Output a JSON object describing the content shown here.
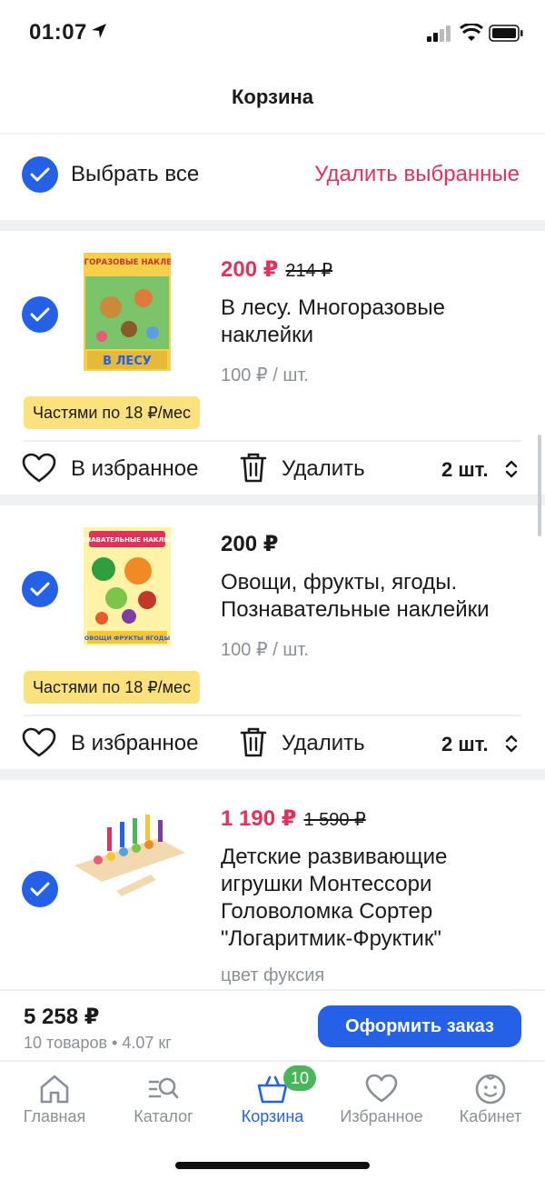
{
  "status_bar": {
    "time": "01:07"
  },
  "header": {
    "title": "Корзина"
  },
  "select_all": {
    "label": "Выбрать все",
    "delete_selected": "Удалить выбранные"
  },
  "items": [
    {
      "price": "200 ₽",
      "old_price": "214 ₽",
      "name": "В лесу. Многоразовые наклейки",
      "unit_price": "100 ₽ / шт.",
      "installment": "Частями по 18 ₽/мес",
      "favorite_label": "В избранное",
      "delete_label": "Удалить",
      "quantity": "2 шт.",
      "cover_title": "МНОГОРАЗОВЫЕ НАКЛЕЙКИ",
      "cover_bottom": "В ЛЕСУ"
    },
    {
      "price": "200 ₽",
      "name": "Овощи, фрукты, ягоды. Познавательные наклейки",
      "unit_price": "100 ₽ / шт.",
      "installment": "Частями по 18 ₽/мес",
      "favorite_label": "В избранное",
      "delete_label": "Удалить",
      "quantity": "2 шт.",
      "cover_title": "ПОЗНАВАТЕЛЬНЫЕ НАКЛЕЙКИ",
      "cover_bottom": "ОВОЩИ ФРУКТЫ ЯГОДЫ"
    },
    {
      "price": "1 190 ₽",
      "old_price": "1 590 ₽",
      "name": "Детские развивающие игрушки Монтессори Головоломка Сортер \"Логаритмик-Фруктик\"",
      "color_option": "цвет фуксия"
    }
  ],
  "summary": {
    "total": "5 258 ₽",
    "details": "10 товаров • 4.07 кг",
    "checkout_label": "Оформить заказ"
  },
  "tabbar": {
    "tabs": [
      {
        "label": "Главная",
        "icon": "home-icon"
      },
      {
        "label": "Каталог",
        "icon": "catalog-search-icon"
      },
      {
        "label": "Корзина",
        "icon": "basket-icon",
        "active": true,
        "badge": "10"
      },
      {
        "label": "Избранное",
        "icon": "heart-icon"
      },
      {
        "label": "Кабинет",
        "icon": "profile-face-icon"
      }
    ]
  },
  "colors": {
    "accent": "#2461e6",
    "sale": "#e0335c",
    "installment_bg": "#fbe27f",
    "badge": "#4bb55b"
  }
}
